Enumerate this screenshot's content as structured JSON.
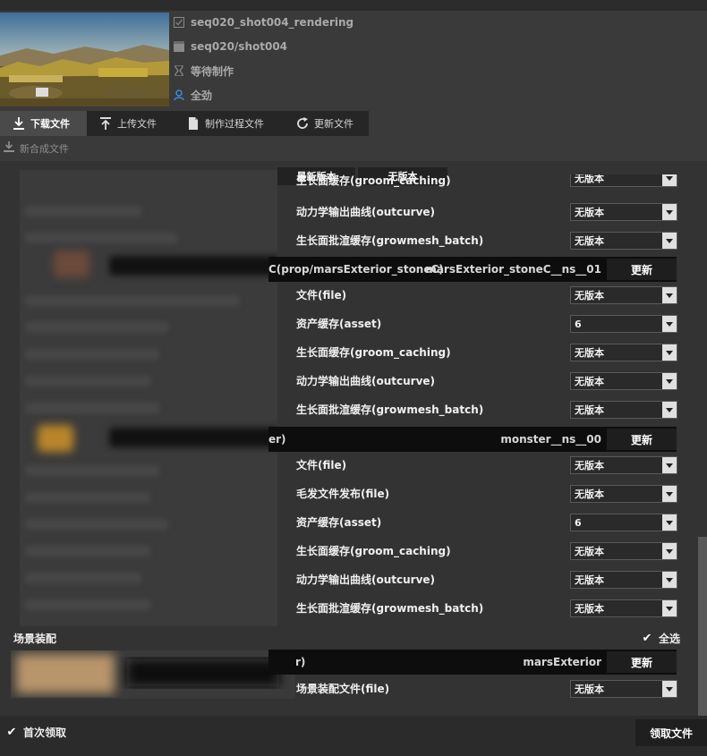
{
  "task": {
    "name": "seq020_shot004_rendering",
    "shot": "seq020/shot004",
    "status": "等待制作",
    "assignee": "全劲"
  },
  "tabs": [
    {
      "label": "下载文件",
      "icon": "download-icon"
    },
    {
      "label": "上传文件",
      "icon": "upload-icon"
    },
    {
      "label": "制作过程文件",
      "icon": "file-icon"
    },
    {
      "label": "更新文件",
      "icon": "refresh-icon"
    }
  ],
  "new_composite_label": "新合成文件",
  "header_buttons": {
    "latest": "最新版本",
    "no_version": "无版本"
  },
  "rows_group0": [
    {
      "label": "生长面缓存(groom_caching)",
      "value": "无版本"
    },
    {
      "label": "动力学输出曲线(outcurve)",
      "value": "无版本"
    },
    {
      "label": "生长面批渲缓存(growmesh_batch)",
      "value": "无版本"
    }
  ],
  "asset1": {
    "left_text": "C(prop/marsExterior_stoneC)",
    "namespace": "marsExterior_stoneC__ns__01",
    "update": "更新",
    "rows": [
      {
        "label": "文件(file)",
        "value": "无版本"
      },
      {
        "label": "资产缓存(asset)",
        "value": "6"
      },
      {
        "label": "生长面缓存(groom_caching)",
        "value": "无版本"
      },
      {
        "label": "动力学输出曲线(outcurve)",
        "value": "无版本"
      },
      {
        "label": "生长面批渲缓存(growmesh_batch)",
        "value": "无版本"
      }
    ]
  },
  "asset2": {
    "left_text": "er)",
    "namespace": "monster__ns__00",
    "update": "更新",
    "rows": [
      {
        "label": "文件(file)",
        "value": "无版本"
      },
      {
        "label": "毛发文件发布(file)",
        "value": "无版本"
      },
      {
        "label": "资产缓存(asset)",
        "value": "6"
      },
      {
        "label": "生长面缓存(groom_caching)",
        "value": "无版本"
      },
      {
        "label": "动力学输出曲线(outcurve)",
        "value": "无版本"
      },
      {
        "label": "生长面批渲缓存(growmesh_batch)",
        "value": "无版本"
      }
    ]
  },
  "scene": {
    "section_title": "场景装配",
    "select_all": "全选",
    "left_text": "r)",
    "namespace": "marsExterior",
    "update": "更新",
    "row_label": "场景装配文件(file)",
    "row_value": "无版本"
  },
  "footer": {
    "first_fetch": "首次领取",
    "fetch_button": "领取文件"
  }
}
